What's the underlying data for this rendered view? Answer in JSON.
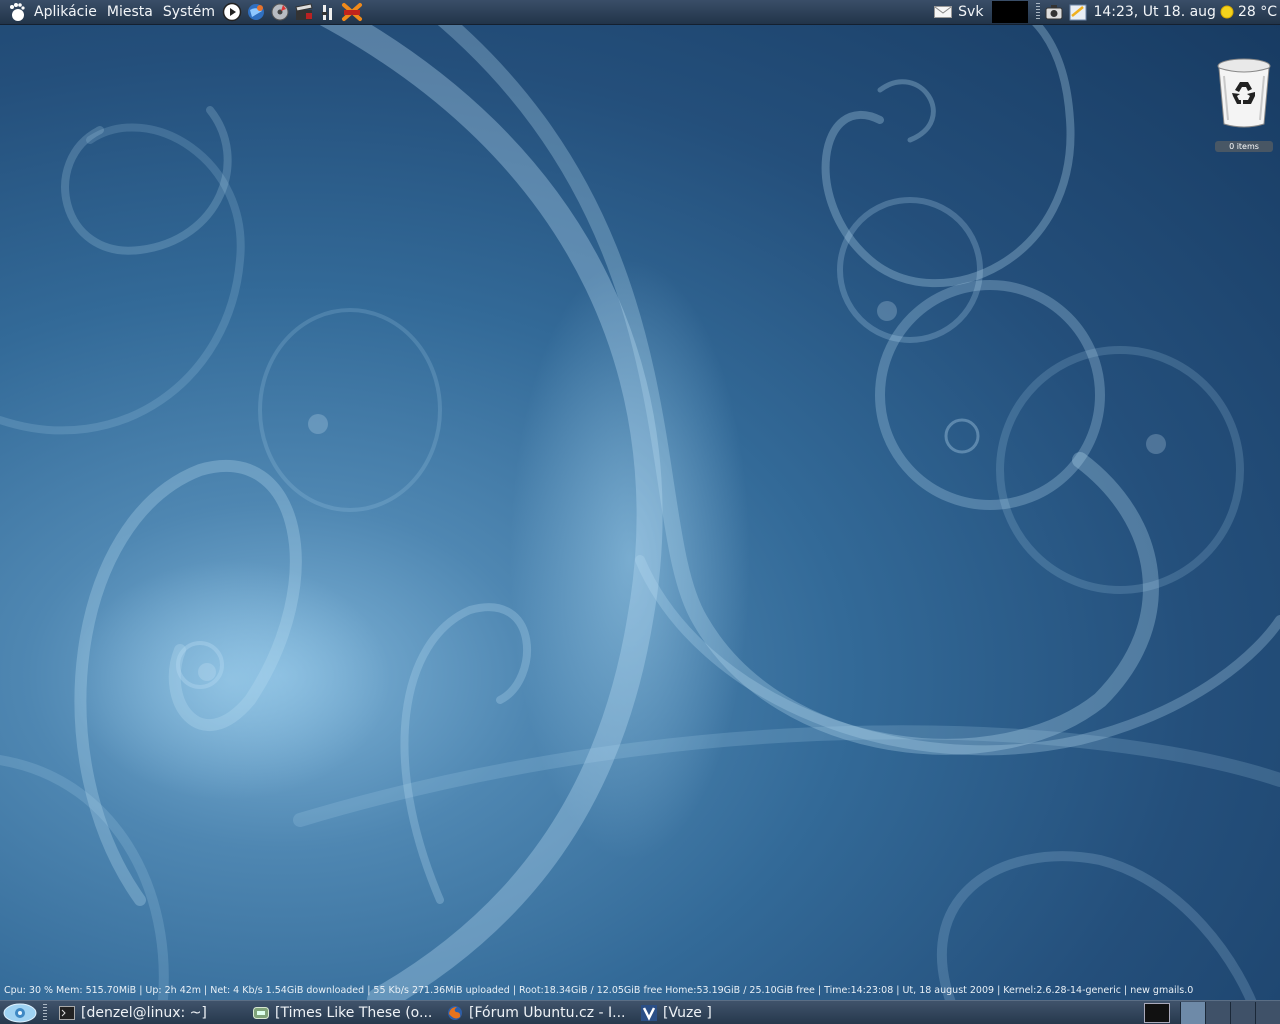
{
  "top_panel": {
    "menus": [
      "Aplikácie",
      "Miesta",
      "Systém"
    ],
    "launchers": [
      "media-player-icon",
      "globe-browser-icon",
      "disc-burner-icon",
      "movie-clapper-icon",
      "audio-mixer-icon",
      "xchat-icon"
    ],
    "keyboard_layout": "Svk",
    "clock": "14:23, Ut 18. aug",
    "temperature": "28 °C"
  },
  "desktop": {
    "trash": {
      "label": "0 items"
    }
  },
  "conky": {
    "status_line": "Cpu: 30 %   Mem: 515.70MiB  |  Up: 2h 42m  |  Net: 4     Kb/s  1.54GiB  downloaded |  55    Kb/s  271.36MiB uploaded | Root:18.34GiB  / 12.05GiB  free  Home:53.19GiB  / 25.10GiB  free  | Time:14:23:08 | Ut, 18 august 2009   | Kernel:2.6.28-14-generic | new gmails.0"
  },
  "bottom_panel": {
    "tasks": [
      {
        "label": "[denzel@linux: ~]",
        "icon": "terminal-icon"
      },
      {
        "label": "[Times Like These (o...",
        "icon": "music-player-icon"
      },
      {
        "label": "[Fórum Ubuntu.cz - I...",
        "icon": "firefox-icon"
      },
      {
        "label": "[Vuze  ]",
        "icon": "vuze-icon"
      }
    ],
    "workspaces": 4
  },
  "colors": {
    "panel": "#2c3e55",
    "wallpaper_accent": "#7fb4d8"
  }
}
